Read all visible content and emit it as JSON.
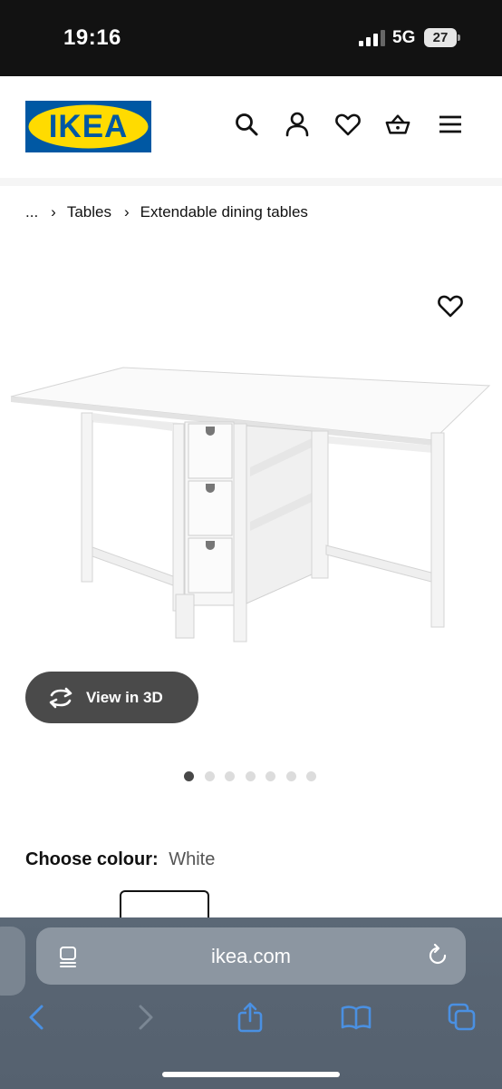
{
  "status_bar": {
    "time": "19:16",
    "network": "5G",
    "battery": "27"
  },
  "header": {
    "logo_text": "IKEA",
    "icons": [
      "search-icon",
      "user-icon",
      "heart-icon",
      "basket-icon",
      "menu-icon"
    ]
  },
  "breadcrumb": {
    "ellipsis": "...",
    "items": [
      "Tables",
      "Extendable dining tables"
    ]
  },
  "product": {
    "view_3d_label": "View in 3D",
    "carousel": {
      "count": 7,
      "active_index": 0
    },
    "colour_label": "Choose colour:",
    "colour_value": "White"
  },
  "browser": {
    "address": "ikea.com"
  },
  "colors": {
    "ikea_blue": "#0058a3",
    "ikea_yellow": "#ffdb00",
    "button_dark": "#4a4a4a",
    "toolbar_blue": "#4a90e2"
  }
}
